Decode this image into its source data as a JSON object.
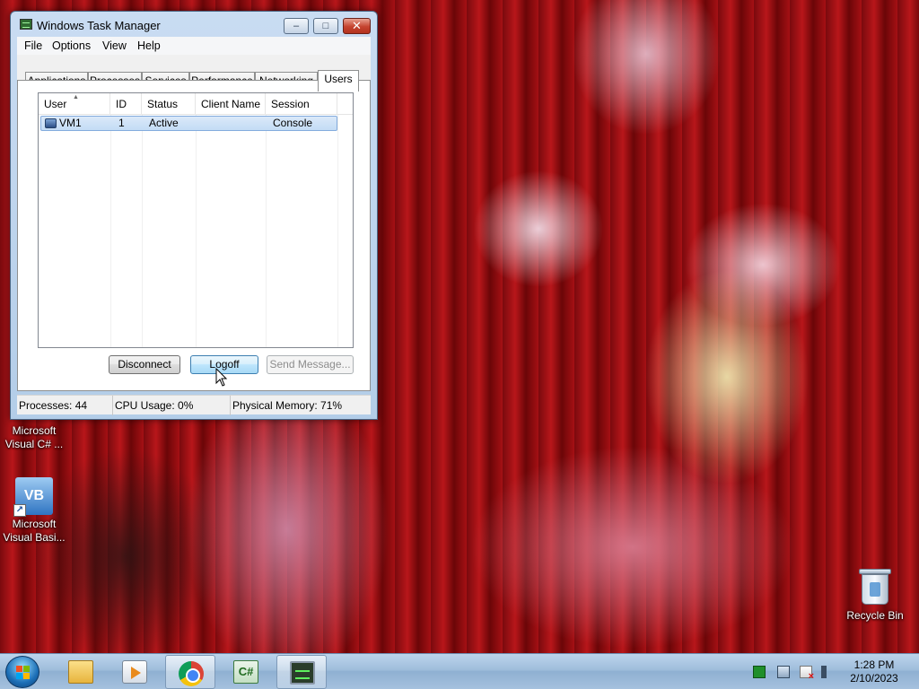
{
  "window": {
    "title": "Windows Task Manager",
    "caption_buttons": {
      "minimize": "–",
      "maximize": "□",
      "close": "✕"
    }
  },
  "menu": [
    "File",
    "Options",
    "View",
    "Help"
  ],
  "tabs": [
    "Applications",
    "Processes",
    "Services",
    "Performance",
    "Networking",
    "Users"
  ],
  "active_tab": "Users",
  "users_table": {
    "columns": [
      "User",
      "ID",
      "Status",
      "Client Name",
      "Session"
    ],
    "rows": [
      {
        "user": "VM1",
        "id": "1",
        "status": "Active",
        "client_name": "",
        "session": "Console"
      }
    ]
  },
  "buttons": {
    "disconnect": "Disconnect",
    "logoff": "Logoff",
    "send_message": "Send Message..."
  },
  "status": {
    "processes": "Processes: 44",
    "cpu": "CPU Usage: 0%",
    "memory": "Physical Memory: 71%"
  },
  "desktop_icons": {
    "visual_csharp": "Microsoft Visual C# ...",
    "visual_basic_line1": "Microsoft",
    "visual_basic_line2": "Visual Basi...",
    "visual_basic_glyph": "VB",
    "visual_csharp_line1": "Microsoft",
    "visual_csharp_line2": "Visual C# ...",
    "recycle_bin": "Recycle Bin"
  },
  "taskbar": {
    "clock_time": "1:28 PM",
    "clock_date": "2/10/2023",
    "csharp_glyph": "C#"
  },
  "colors": {
    "title_bar": "#c9dcf2",
    "selected_row": "#c3dcf5",
    "taskbar": "#9fbddb"
  }
}
